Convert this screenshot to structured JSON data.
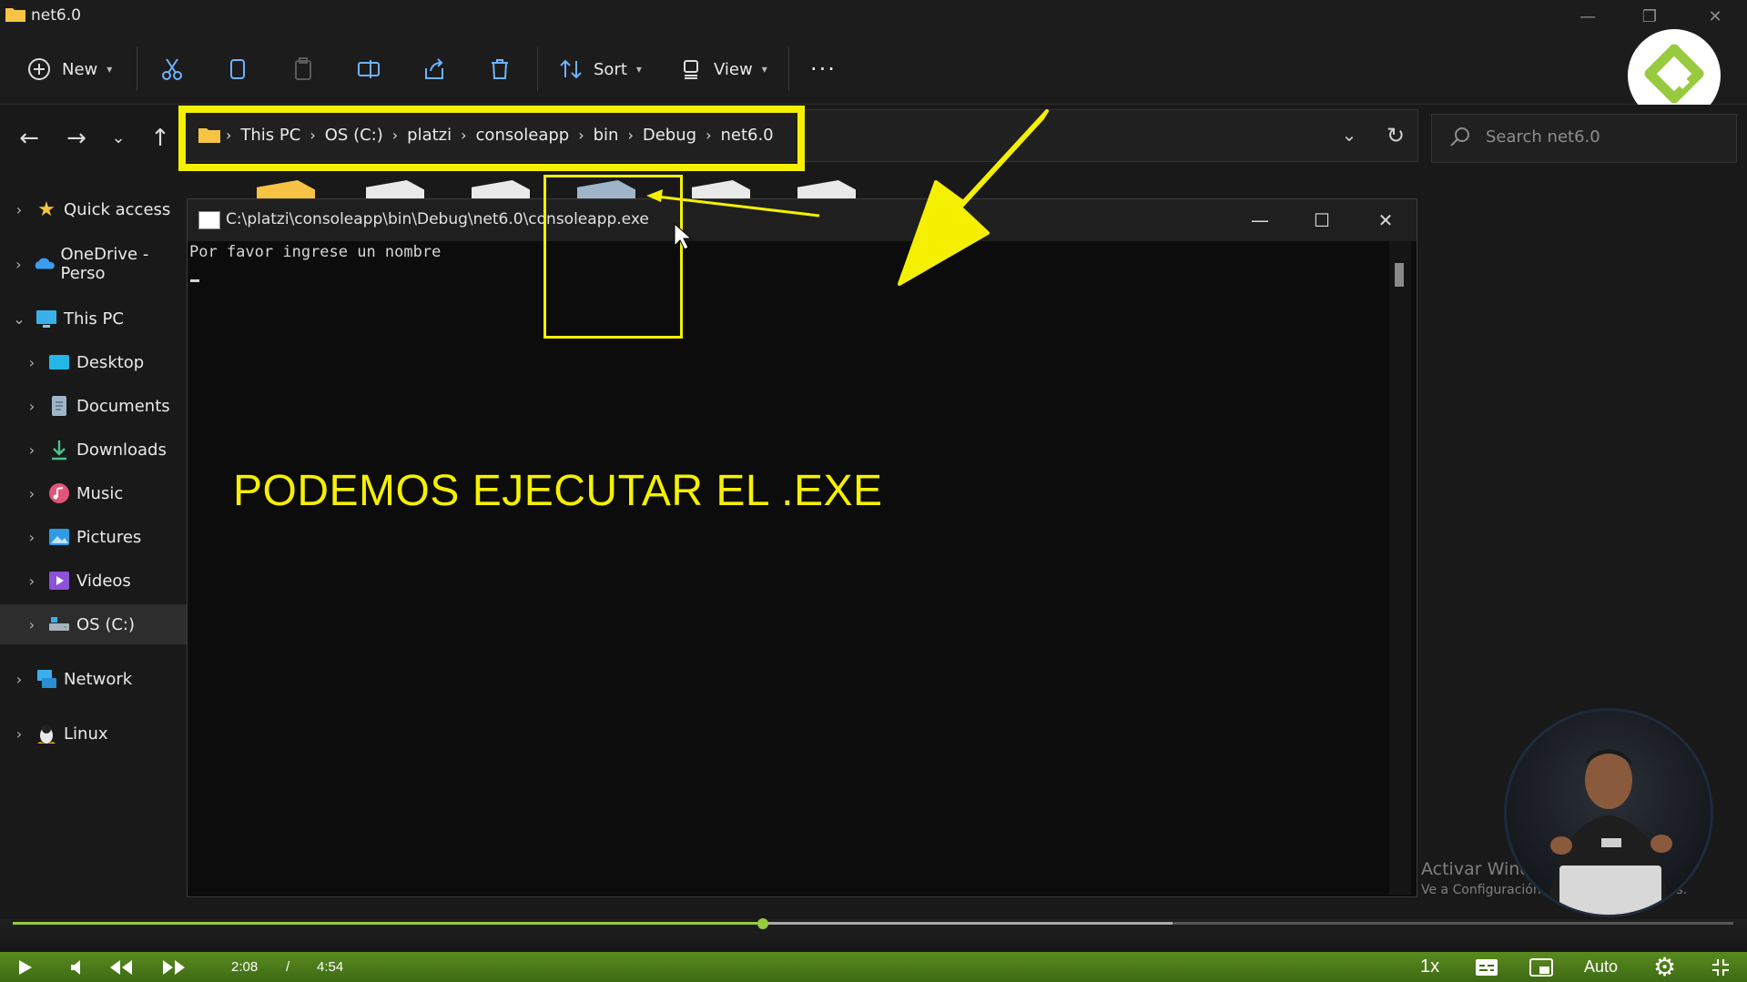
{
  "window": {
    "title": "net6.0",
    "minimize": "—",
    "maximize": "❐",
    "close": "✕"
  },
  "toolbar": {
    "new_label": "New",
    "sort_label": "Sort",
    "view_label": "View",
    "more_label": "···"
  },
  "address": {
    "crumbs": [
      "This PC",
      "OS (C:)",
      "platzi",
      "consoleapp",
      "bin",
      "Debug",
      "net6.0"
    ],
    "separator": "›"
  },
  "search": {
    "placeholder": "Search net6.0"
  },
  "sidebar": {
    "items": [
      {
        "label": "Quick access",
        "icon": "star-icon"
      },
      {
        "label": "OneDrive - Perso",
        "icon": "cloud-icon"
      },
      {
        "label": "This PC",
        "icon": "monitor-icon"
      },
      {
        "label": "Desktop",
        "icon": "desktop-icon"
      },
      {
        "label": "Documents",
        "icon": "document-icon"
      },
      {
        "label": "Downloads",
        "icon": "download-icon"
      },
      {
        "label": "Music",
        "icon": "music-icon"
      },
      {
        "label": "Pictures",
        "icon": "picture-icon"
      },
      {
        "label": "Videos",
        "icon": "video-icon"
      },
      {
        "label": "OS (C:)",
        "icon": "drive-icon"
      },
      {
        "label": "Network",
        "icon": "network-icon"
      },
      {
        "label": "Linux",
        "icon": "linux-icon"
      }
    ]
  },
  "console": {
    "title": "C:\\platzi\\consoleapp\\bin\\Debug\\net6.0\\consoleapp.exe",
    "output": "Por favor ingrese un nombre",
    "minimize": "—",
    "maximize": "☐",
    "close": "✕"
  },
  "overlay": {
    "caption": "PODEMOS EJECUTAR EL .EXE"
  },
  "watermark": {
    "title": "Activar Windows",
    "subtitle": "Ve a Configuración para activar Windows."
  },
  "player": {
    "current_time": "2:08",
    "separator": "/",
    "duration": "4:54",
    "speed": "1x",
    "quality": "Auto",
    "progress_fraction": 0.436,
    "buffered_fraction": 0.674
  },
  "colors": {
    "highlight": "#f5f000",
    "player_accent": "#98ca3f"
  }
}
